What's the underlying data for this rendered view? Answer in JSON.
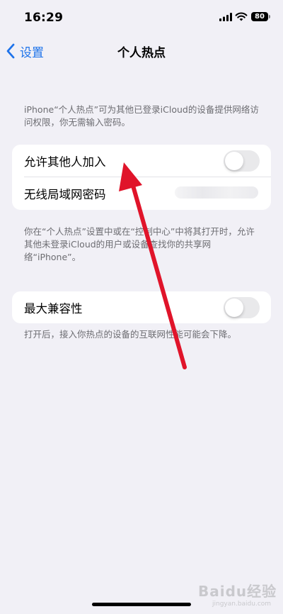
{
  "status_bar": {
    "time": "16:29",
    "battery": "80",
    "icons": [
      "signal-icon",
      "wifi-icon",
      "battery-icon"
    ]
  },
  "nav": {
    "back_label": "设置",
    "title": "个人热点",
    "back_icon": "chevron-left-icon"
  },
  "intro_text": "iPhone“个人热点”可为其他已登录iCloud的设备提供网络访问权限，你无需输入密码。",
  "hotspot_card": {
    "allow_others": {
      "label": "允许其他人加入",
      "toggle_on": false
    },
    "wifi_password": {
      "label": "无线局域网密码"
    }
  },
  "hotspot_footnote": "你在“个人热点”设置中或在“控制中心”中将其打开时，允许其他未登录iCloud的用户或设备查找你的共享网络“iPhone”。",
  "compat_card": {
    "max_compat": {
      "label": "最大兼容性",
      "toggle_on": false
    }
  },
  "compat_footnote": "打开后，接入你热点的设备的互联网性能可能会下降。",
  "watermark": {
    "title": "Baidu经验",
    "url": "jingyan.baidu.com"
  },
  "colors": {
    "background": "#f1f0f6",
    "accent": "#1e73ea",
    "annotation_arrow": "#e0142a",
    "toggle_off": "#e9e9eb"
  }
}
